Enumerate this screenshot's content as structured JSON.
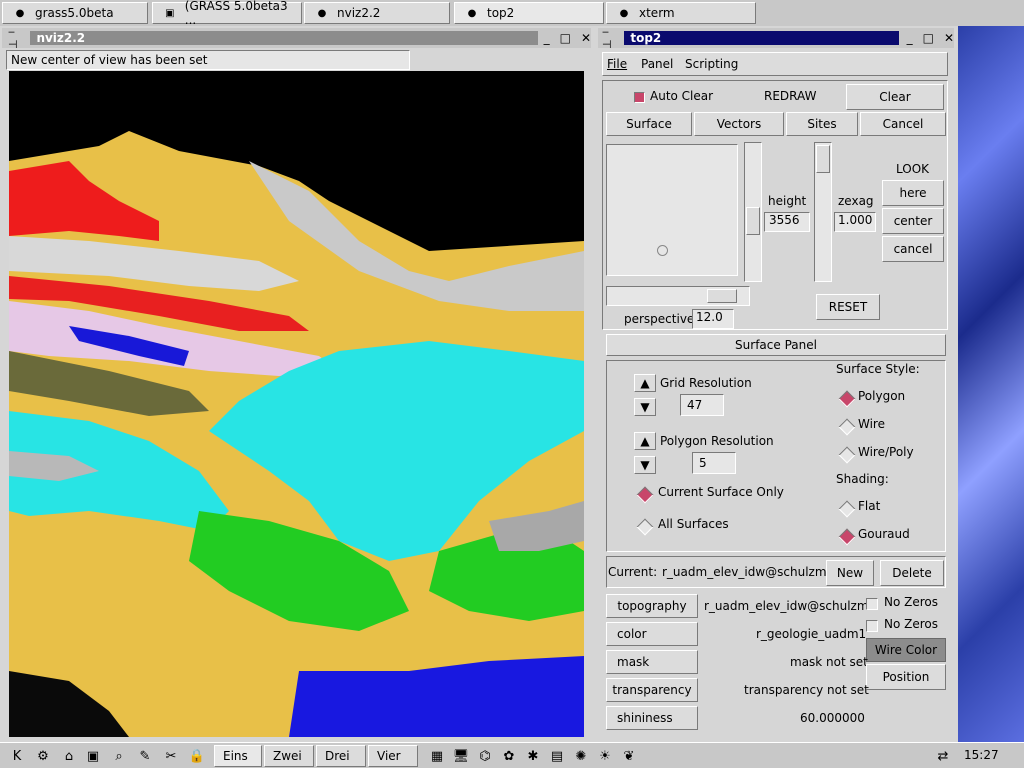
{
  "taskbar": {
    "tabs": [
      {
        "label": "grass5.0beta",
        "icon": "dot-icon"
      },
      {
        "label": "(GRASS 5.0beta3 ...",
        "icon": "terminal-icon"
      },
      {
        "label": "nviz2.2",
        "icon": "dot-icon"
      },
      {
        "label": "top2",
        "icon": "dot-icon"
      },
      {
        "label": "xterm",
        "icon": "dot-icon"
      }
    ]
  },
  "nviz": {
    "title": "nviz2.2",
    "status": "New center of view has been set"
  },
  "top2": {
    "title": "top2",
    "menu": [
      "File",
      "Panel",
      "Scripting"
    ],
    "auto_clear": "Auto Clear",
    "redraw": "REDRAW",
    "clear": "Clear",
    "nav_buttons": [
      "Surface",
      "Vectors",
      "Sites",
      "Cancel"
    ],
    "height_label": "height",
    "height_value": "3556",
    "zexag_label": "zexag",
    "zexag_value": "1.000",
    "look_label": "LOOK",
    "look_buttons": [
      "here",
      "center",
      "cancel"
    ],
    "reset": "RESET",
    "perspective_label": "perspective",
    "perspective_value": "12.0",
    "surface_panel_title": "Surface Panel",
    "grid_res_label": "Grid Resolution",
    "grid_res_value": "47",
    "poly_res_label": "Polygon  Resolution",
    "poly_res_value": "5",
    "current_surface_only": "Current Surface Only",
    "all_surfaces": "All Surfaces",
    "surface_style_label": "Surface Style:",
    "styles": [
      "Polygon",
      "Wire",
      "Wire/Poly"
    ],
    "shading_label": "Shading:",
    "shadings": [
      "Flat",
      "Gouraud"
    ],
    "current_label": "Current:",
    "current_value": "r_uadm_elev_idw@schulzm",
    "new": "New",
    "delete": "Delete",
    "attributes": [
      {
        "button": "topography",
        "value": "r_uadm_elev_idw@schulzm"
      },
      {
        "button": "color",
        "value": "r_geologie_uadm1"
      },
      {
        "button": "mask",
        "value": "mask not set"
      },
      {
        "button": "transparency",
        "value": "transparency not set"
      },
      {
        "button": "shininess",
        "value": "60.000000"
      }
    ],
    "no_zeros": "No Zeros",
    "wire_color": "Wire Color",
    "position": "Position"
  },
  "panel": {
    "desktops": [
      "Eins",
      "Zwei",
      "Drei",
      "Vier"
    ],
    "clock": "15:27"
  },
  "colors": {
    "title_active": "#0a0a6e",
    "title_inactive": "#8c8c8c",
    "radio_on": "#c8466a"
  }
}
